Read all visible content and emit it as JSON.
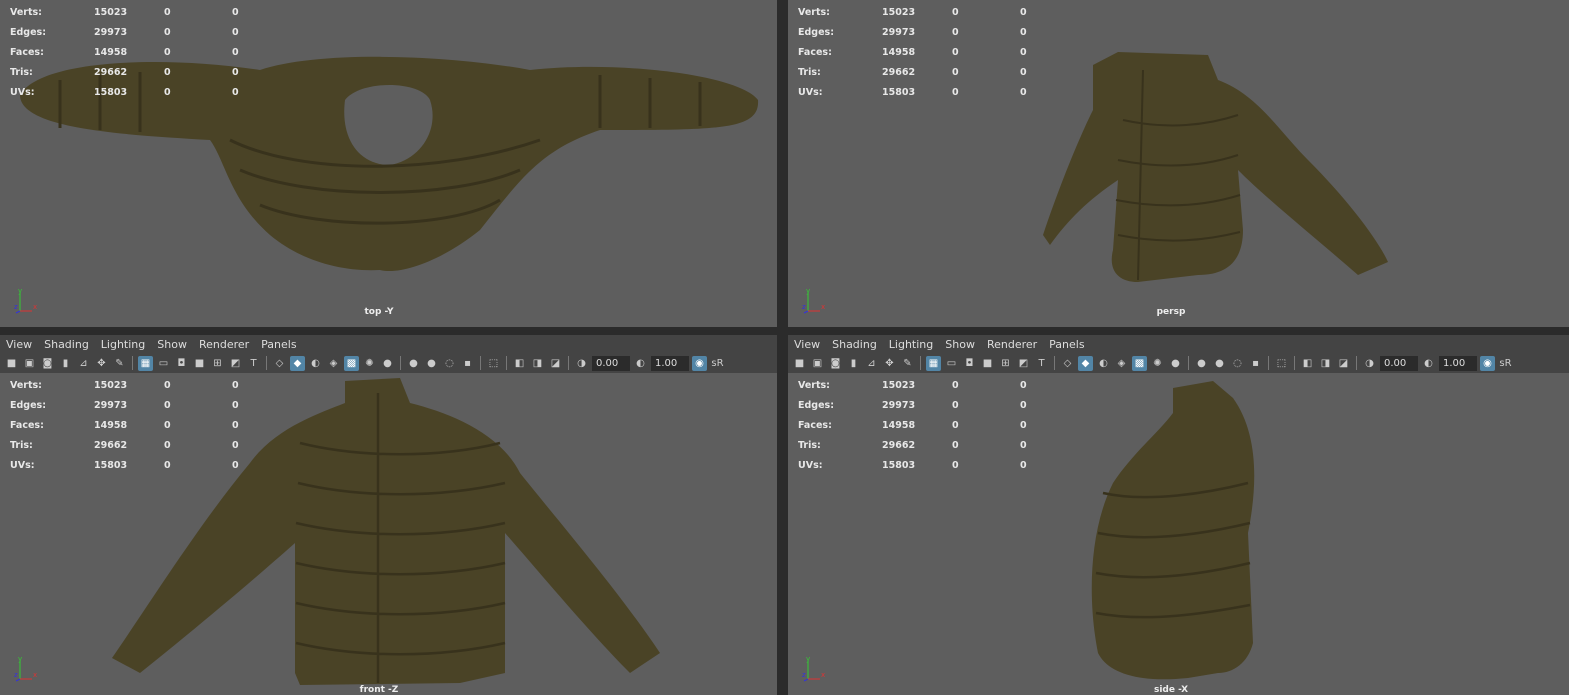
{
  "hud": {
    "labels": [
      "Verts:",
      "Edges:",
      "Faces:",
      "Tris:",
      "UVs:"
    ],
    "values": [
      "15023",
      "29973",
      "14958",
      "29662",
      "15803"
    ],
    "zero": "0"
  },
  "views": {
    "top": "top -Y",
    "persp": "persp",
    "front": "front -Z",
    "side": "side -X"
  },
  "menu": [
    "View",
    "Shading",
    "Lighting",
    "Show",
    "Renderer",
    "Panels"
  ],
  "toolbar": {
    "icons": [
      "camera",
      "camera-lock",
      "camera-attr",
      "bookmark",
      "image-plane",
      "2d-pan",
      "grease-pencil",
      "|",
      "grid",
      "film-gate",
      "resolution-gate",
      "gate-mask",
      "field-chart",
      "safe-action",
      "safe-title",
      "|",
      "wireframe",
      "smooth-shade",
      "shade-default",
      "wireframe-on-shaded",
      "textured",
      "use-lights",
      "shadows",
      "|",
      "screen-ao",
      "motion-blur",
      "anti-alias",
      "depth-of-field",
      "|",
      "isolate-select",
      "|",
      "xray",
      "xray-joints",
      "xray-components",
      "|",
      "exposure",
      "EXPOSURE",
      "gamma",
      "GAMMA",
      "color-mgmt",
      "sR"
    ],
    "active": [
      "grid",
      "smooth-shade",
      "textured",
      "color-mgmt"
    ],
    "exposure": "0.00",
    "gamma": "1.00",
    "srgb": "sR"
  },
  "colors": {
    "viewport": "#5e5e5e",
    "jacket": "#4a4326",
    "accent": "#5285a6"
  }
}
